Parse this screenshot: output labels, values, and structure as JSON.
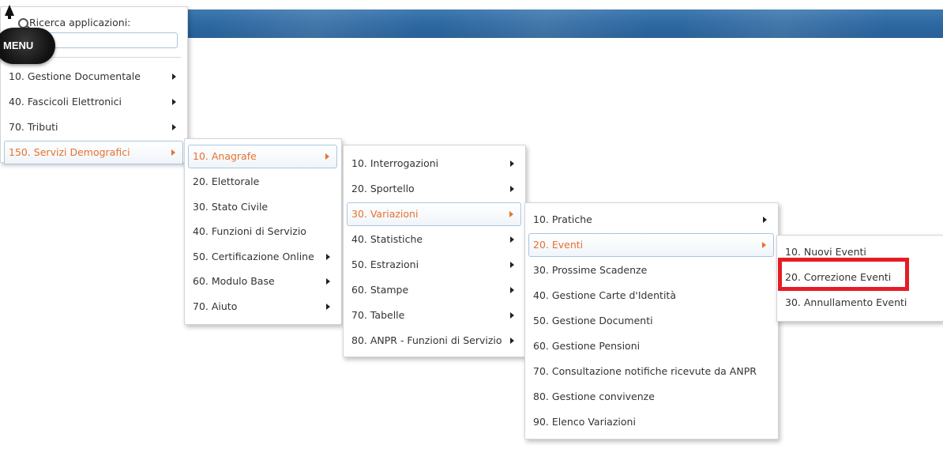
{
  "topbar": {
    "color": "#2f6aa3"
  },
  "badge": {
    "label": "MENU"
  },
  "search": {
    "label": "Ricerca applicazioni:",
    "value": "",
    "placeholder": ""
  },
  "accent_color": "#e8712c",
  "highlight_color": "#e51c24",
  "menus": {
    "main": [
      {
        "label": "10. Gestione Documentale",
        "arrow": true
      },
      {
        "label": "40. Fascicoli Elettronici",
        "arrow": true
      },
      {
        "label": "70. Tributi",
        "arrow": true
      },
      {
        "label": "150. Servizi Demografici",
        "arrow": true,
        "active": true
      }
    ],
    "anagrafe": [
      {
        "label": "10. Anagrafe",
        "arrow": true,
        "active": true
      },
      {
        "label": "20. Elettorale",
        "arrow": false
      },
      {
        "label": "30. Stato Civile",
        "arrow": false
      },
      {
        "label": "40. Funzioni di Servizio",
        "arrow": false
      },
      {
        "label": "50. Certificazione Online",
        "arrow": true
      },
      {
        "label": "60. Modulo Base",
        "arrow": true
      },
      {
        "label": "70. Aiuto",
        "arrow": true
      }
    ],
    "servizio": [
      {
        "label": "10. Interrogazioni",
        "arrow": true
      },
      {
        "label": "20. Sportello",
        "arrow": true
      },
      {
        "label": "30. Variazioni",
        "arrow": true,
        "active": true
      },
      {
        "label": "40. Statistiche",
        "arrow": true
      },
      {
        "label": "50. Estrazioni",
        "arrow": true
      },
      {
        "label": "60. Stampe",
        "arrow": true
      },
      {
        "label": "70. Tabelle",
        "arrow": true
      },
      {
        "label": "80. ANPR - Funzioni di Servizio",
        "arrow": true
      }
    ],
    "variazioni": [
      {
        "label": "10. Pratiche",
        "arrow": true
      },
      {
        "label": "20. Eventi",
        "arrow": true,
        "active": true
      },
      {
        "label": "30. Prossime Scadenze",
        "arrow": false
      },
      {
        "label": "40. Gestione Carte d'Identità",
        "arrow": false
      },
      {
        "label": "50. Gestione Documenti",
        "arrow": false
      },
      {
        "label": "60. Gestione Pensioni",
        "arrow": false
      },
      {
        "label": "70. Consultazione notifiche ricevute da ANPR",
        "arrow": false
      },
      {
        "label": "80. Gestione convivenze",
        "arrow": false
      },
      {
        "label": "90. Elenco Variazioni",
        "arrow": false
      }
    ],
    "eventi": [
      {
        "label": "10. Nuovi Eventi",
        "arrow": false
      },
      {
        "label": "20. Correzione Eventi",
        "arrow": false,
        "highlighted": true
      },
      {
        "label": "30. Annullamento Eventi",
        "arrow": false
      }
    ]
  }
}
